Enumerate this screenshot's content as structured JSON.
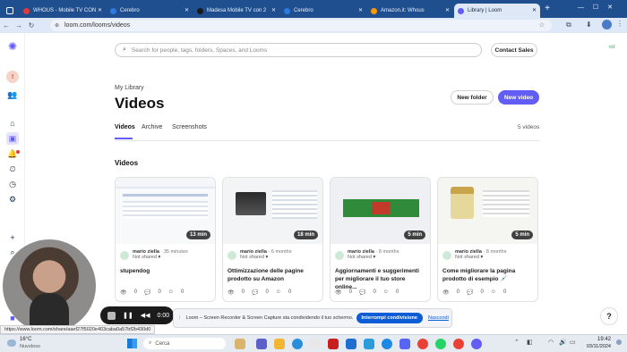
{
  "browser": {
    "tabs": [
      {
        "label": "WHOUS - Mobile TV CON",
        "color": "#e03b3b",
        "active": false
      },
      {
        "label": "Cerebro",
        "color": "#2c7be5",
        "active": false
      },
      {
        "label": "Madesa Mobile TV con 2",
        "color": "#1a1a1a",
        "active": false
      },
      {
        "label": "Cerebro",
        "color": "#2c7be5",
        "active": false
      },
      {
        "label": "Amazon.it: Whous",
        "color": "#ff9900",
        "active": false
      },
      {
        "label": "Library | Loom",
        "color": "#625df5",
        "active": true
      }
    ],
    "url": "loom.com/looms/videos"
  },
  "header": {
    "search_placeholder": "Search for people, tags, folders, Spaces, and Looms",
    "contact_sales": "Contact Sales"
  },
  "page": {
    "breadcrumb": "My Library",
    "title": "Videos",
    "new_folder": "New folder",
    "new_video": "New video",
    "tabs": [
      "Videos",
      "Archive",
      "Screenshots"
    ],
    "count": "5 videos",
    "section": "Videos"
  },
  "videos": [
    {
      "author": "mario ziella",
      "age": "· 35 minutes",
      "status": "Not shared",
      "title": "stupendog",
      "duration": "13 min",
      "views": "0",
      "comments": "0",
      "reactions": "0"
    },
    {
      "author": "mario ziella",
      "age": "· 6 months",
      "status": "Not shared",
      "title": "Ottimizzazione delle pagine prodotto su Amazon",
      "duration": "18 min",
      "views": "0",
      "comments": "0",
      "reactions": "0"
    },
    {
      "author": "mario ziella",
      "age": "· 8 months",
      "status": "Not shared",
      "title": "Aggiornamenti e suggerimenti per migliorare il tuo store online...",
      "duration": "5 min",
      "views": "0",
      "comments": "0",
      "reactions": "0"
    },
    {
      "author": "mario ziella",
      "age": "· 8 months",
      "status": "Not shared",
      "title": "Come migliorare la pagina prodotto di esempio 💉",
      "duration": "5 min",
      "views": "0",
      "comments": "0",
      "reactions": "0"
    }
  ],
  "recorder": {
    "time": "0:00"
  },
  "share_bar": {
    "message": "Loom – Screen Recorder & Screen Capture sta condividendo il tuo schermo.",
    "stop": "Interrompi condivisione",
    "hide": "Nascondi"
  },
  "status_url": "https://www.loom.com/share/aaef27f5020e403caba0a57bf2b430d0",
  "taskbar": {
    "weather_temp": "16°C",
    "weather_desc": "Nuvoloso",
    "search": "Cerca",
    "time": "19:42",
    "date": "03/11/2024"
  }
}
